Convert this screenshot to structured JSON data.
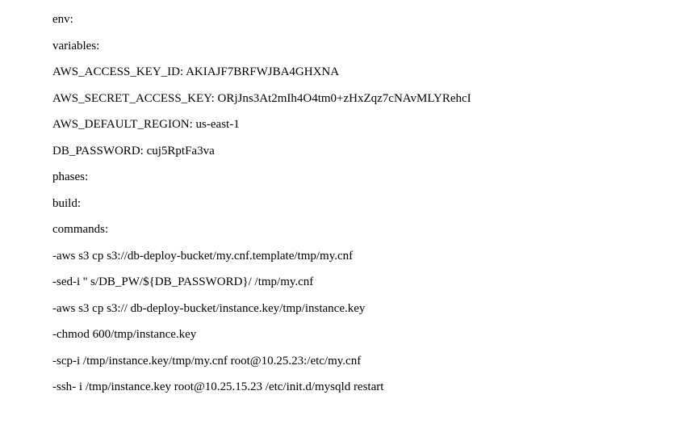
{
  "lines": {
    "l0": "env:",
    "l1": "variables:",
    "l2": "AWS_ACCESS_KEY_ID: AKIAJF7BRFWJBA4GHXNA",
    "l3": "AWS_SECRET_ACCESS_KEY: ORjJns3At2mIh4O4tm0+zHxZqz7cNAvMLYRehcI",
    "l4": "AWS_DEFAULT_REGION: us-east-1",
    "l5": "DB_PASSWORD: cuj5RptFa3va",
    "l6": "phases:",
    "l7": "build:",
    "l8": "commands:",
    "l9": "-aws s3 cp s3://db-deploy-bucket/my.cnf.template/tmp/my.cnf",
    "l10": "-sed-i '' s/DB_PW/${DB_PASSWORD}/ /tmp/my.cnf",
    "l11": "-aws s3 cp s3:// db-deploy-bucket/instance.key/tmp/instance.key",
    "l12": "-chmod 600/tmp/instance.key",
    "l13": "-scp-i /tmp/instance.key/tmp/my.cnf root@10.25.23:/etc/my.cnf",
    "l14": "-ssh- i /tmp/instance.key root@10.25.15.23 /etc/init.d/mysqld restart"
  }
}
